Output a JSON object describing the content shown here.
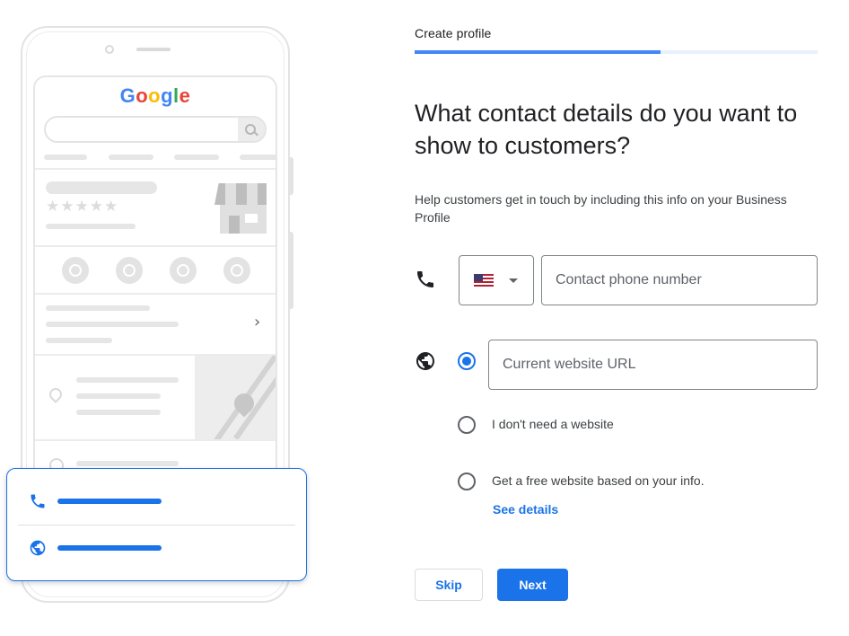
{
  "illustration": {
    "logo_letters": [
      {
        "char": "G",
        "color": "#4285f4"
      },
      {
        "char": "o",
        "color": "#ea4335"
      },
      {
        "char": "o",
        "color": "#fbbc05"
      },
      {
        "char": "g",
        "color": "#4285f4"
      },
      {
        "char": "l",
        "color": "#34a853"
      },
      {
        "char": "e",
        "color": "#ea4335"
      }
    ],
    "stars": "★★★★★",
    "chevron": "›",
    "card_icons": [
      "phone-icon",
      "globe-icon"
    ]
  },
  "header": {
    "step_label": "Create profile",
    "progress_fraction": 0.61
  },
  "main": {
    "headline": "What contact details do you want to show to customers?",
    "help_text": "Help customers get in touch by including this info on your Business Profile",
    "phone": {
      "icon": "phone-icon",
      "country_icon": "us-flag-icon",
      "placeholder": "Contact phone number",
      "value": ""
    },
    "website": {
      "icon": "globe-icon",
      "placeholder": "Current website URL",
      "value": "",
      "options": [
        {
          "label": "",
          "checked": true
        },
        {
          "label": "I don't need a website",
          "checked": false
        },
        {
          "label": "Get a free website based on your info.",
          "checked": false
        }
      ],
      "see_details": "See details"
    }
  },
  "actions": {
    "skip_label": "Skip",
    "next_label": "Next"
  },
  "colors": {
    "accent": "#1a73e8",
    "progress": "#4285f4",
    "progress_track": "#e8f0fe"
  }
}
